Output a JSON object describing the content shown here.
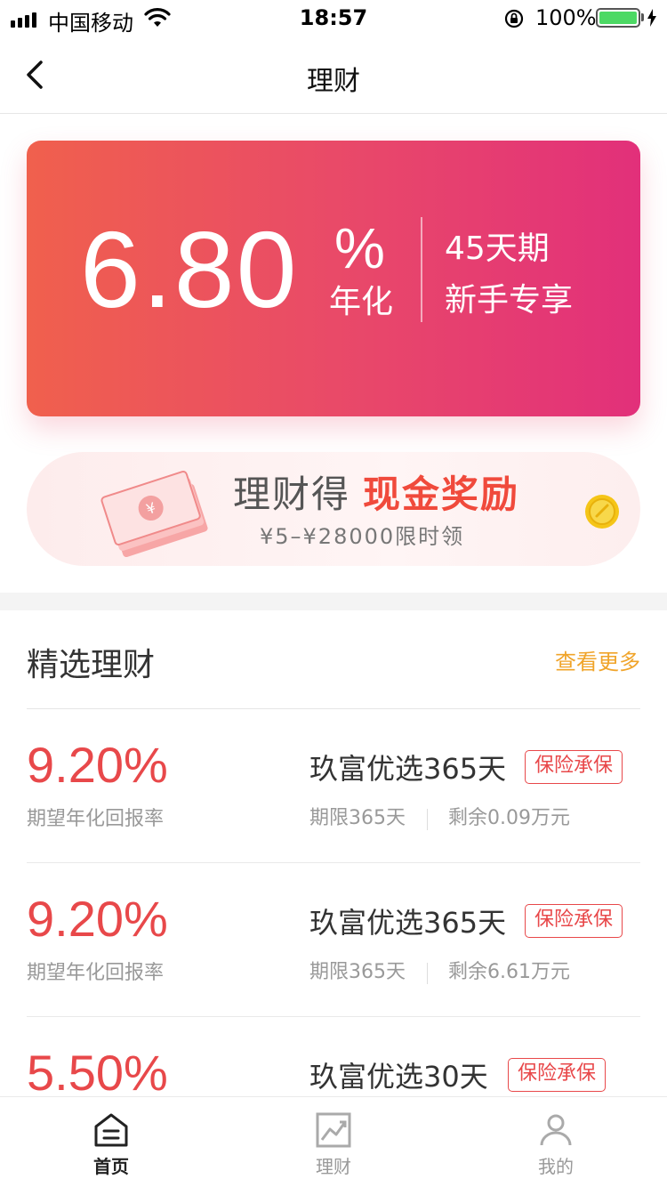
{
  "status_bar": {
    "carrier": "中国移动",
    "time": "18:57",
    "battery": "100%"
  },
  "nav": {
    "title": "理财"
  },
  "hero": {
    "rate": "6.80",
    "percent_sign": "%",
    "annual_label": "年化",
    "term": "45天期",
    "tag": "新手专享"
  },
  "promo": {
    "title_prefix": "理财得",
    "title_highlight": "现金奖励",
    "subtitle": "¥5–¥28000限时领"
  },
  "section": {
    "title": "精选理财",
    "more": "查看更多"
  },
  "products": [
    {
      "rate": "9.20%",
      "rate_label": "期望年化回报率",
      "name": "玖富优选365天",
      "badge": "保险承保",
      "term": "期限365天",
      "remaining": "剩余0.09万元"
    },
    {
      "rate": "9.20%",
      "rate_label": "期望年化回报率",
      "name": "玖富优选365天",
      "badge": "保险承保",
      "term": "期限365天",
      "remaining": "剩余6.61万元"
    },
    {
      "rate": "5.50%",
      "name": "玖富优选30天",
      "badge": "保险承保"
    }
  ],
  "tabs": [
    {
      "label": "首页",
      "icon": "home-icon",
      "active": true
    },
    {
      "label": "理财",
      "icon": "chart-icon",
      "active": false
    },
    {
      "label": "我的",
      "icon": "user-icon",
      "active": false
    }
  ],
  "colors": {
    "accent_red": "#e8484a",
    "more_link": "#f0a42a",
    "hero_gradient_start": "#f0604d",
    "hero_gradient_end": "#e2307a"
  }
}
